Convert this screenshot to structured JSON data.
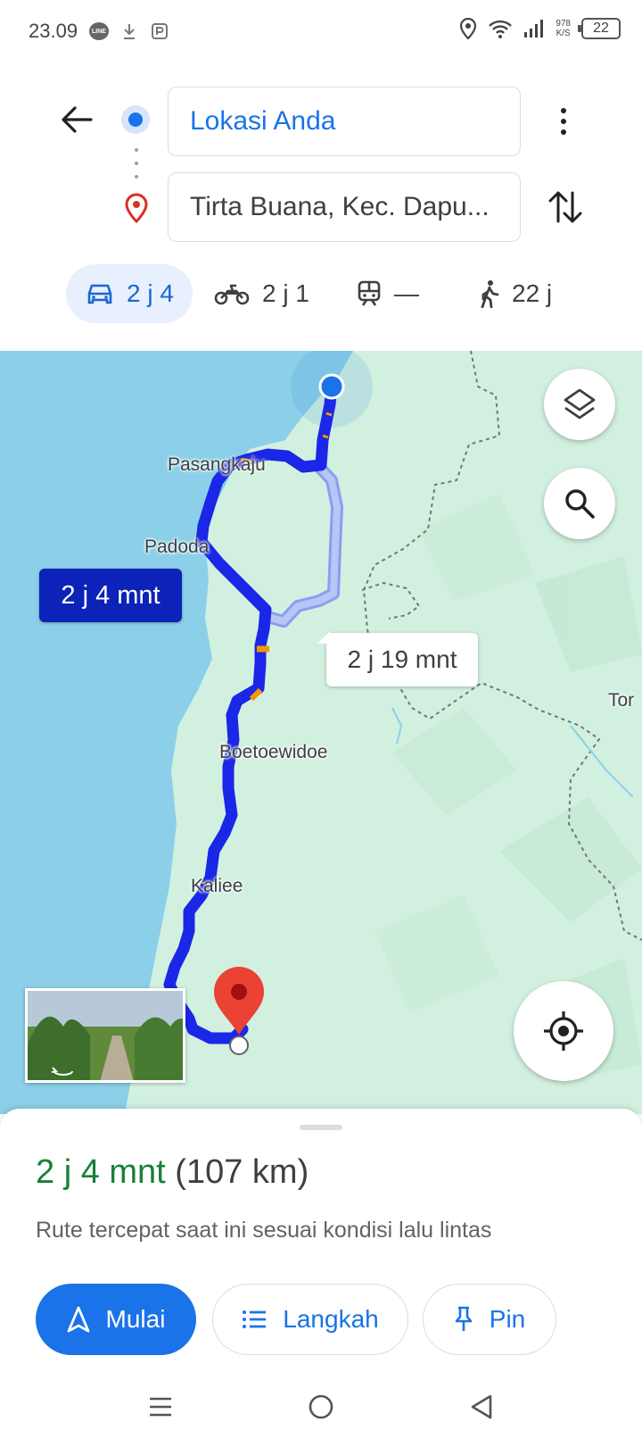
{
  "status_bar": {
    "time": "23.09",
    "net_speed_value": "978",
    "net_speed_unit": "K/S",
    "battery": "22",
    "line_badge": "LINE"
  },
  "directions": {
    "origin": "Lokasi Anda",
    "destination": "Tirta Buana, Kec. Dapu..."
  },
  "modes": [
    {
      "name": "car",
      "label": "2 j 4",
      "selected": true
    },
    {
      "name": "motorcycle",
      "label": "2 j 1"
    },
    {
      "name": "transit",
      "label": "—"
    },
    {
      "name": "walk",
      "label": "22 j"
    }
  ],
  "map": {
    "places": [
      "Pasangkaju",
      "Padoda",
      "Boetoewidoe",
      "Kaliee",
      "Tor"
    ],
    "route_primary_time": "2 j 4 mnt",
    "route_alt_time": "2 j 19 mnt",
    "colors": {
      "route": "#1a27e6",
      "route_alt": "#a9b8f5",
      "water": "#8bd0e8",
      "land": "#d2f0e0"
    }
  },
  "summary": {
    "time": "2 j 4 mnt",
    "distance": "(107 km)",
    "note": "Rute tercepat saat ini sesuai kondisi lalu lintas"
  },
  "actions": {
    "start": "Mulai",
    "steps": "Langkah",
    "pin": "Pin"
  }
}
